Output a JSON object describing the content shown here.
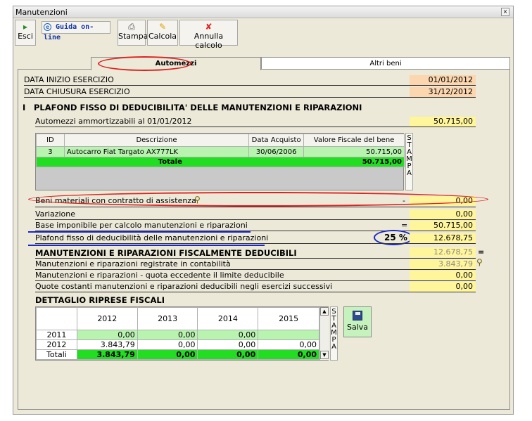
{
  "window": {
    "title": "Manutenzioni",
    "close_glyph": "×"
  },
  "toolbar": {
    "esci": "Esci",
    "guida": "Guida on-line",
    "stampa": "Stampa",
    "calcola": "Calcola",
    "annulla": "Annulla calcolo"
  },
  "tabs": [
    {
      "label": "Automezzi",
      "active": true
    },
    {
      "label": "Altri beni",
      "active": false
    }
  ],
  "esercizio": {
    "inizio_label": "DATA INIZIO ESERCIZIO",
    "inizio_value": "01/01/2012",
    "chiusura_label": "DATA CHIUSURA ESERCIZIO",
    "chiusura_value": "31/12/2012"
  },
  "section1": {
    "numeral": "I",
    "title": "PLAFOND FISSO DI DEDUCIBILITA' DELLE MANUTENZIONI E  RIPARAZIONI",
    "automezzi_label": "Automezzi ammortizzabili al 01/01/2012",
    "automezzi_value": "50.715,00"
  },
  "assets_table": {
    "headers": [
      "ID",
      "Descrizione",
      "Data Acquisto",
      "Valore Fiscale del bene"
    ],
    "rows": [
      {
        "id": "3",
        "descrizione": "Autocarro Fiat Targato AX777LK",
        "data": "30/06/2006",
        "valore": "50.715,00"
      }
    ],
    "total_label": "Totale",
    "total_value": "50.715,00"
  },
  "stampa_letters": [
    "S",
    "T",
    "A",
    "M",
    "P",
    "A"
  ],
  "calc": {
    "beni_label": "Beni materiali con contratto di assistenza",
    "beni_op": "-",
    "beni_value": "0,00",
    "variazione_label": "Variazione",
    "variazione_value": "0,00",
    "base_label": "Base imponibile per calcolo manutenzioni e riparazioni",
    "base_op": "=",
    "base_value": "50.715,00",
    "plafond_label": "Plafond fisso di deducibilità delle manutenzioni e riparazioni",
    "plafond_pct": "25 %",
    "plafond_value": "12.678,75"
  },
  "section2": {
    "title": "MANUTENZIONI E RIPARAZIONI FISCALMENTE DEDUCIBILI",
    "title_value": "12.678,75",
    "title_op": "=",
    "registrate_label": "Manutenzioni e riparazioni registrate in contabilità",
    "registrate_value": "3.843,79",
    "eccedente_label": "Manutenzioni e riparazioni - quota eccedente il limite deducibile",
    "eccedente_value": "0,00",
    "quote_label": "Quote costanti manutenzioni e riparazioni deducibili negli esercizi successivi",
    "quote_value": "0,00"
  },
  "riprese": {
    "title": "DETTAGLIO RIPRESE FISCALI",
    "years": [
      "2012",
      "2013",
      "2014",
      "2015"
    ],
    "rows": [
      {
        "label": "2011",
        "values": [
          "0,00",
          "0,00",
          "0,00",
          ""
        ]
      },
      {
        "label": "2012",
        "values": [
          "3.843,79",
          "0,00",
          "0,00",
          "0,00"
        ]
      }
    ],
    "totals_label": "Totali",
    "totals": [
      "3.843,79",
      "0,00",
      "0,00",
      "0,00"
    ]
  },
  "salva_label": "Salva",
  "colors": {
    "yellow": "#fff59a",
    "peach": "#fbd6ae",
    "green_light": "#b8f3b0",
    "green": "#22dd22",
    "annot_red": "#e02020",
    "annot_blue": "#1a27c9"
  }
}
